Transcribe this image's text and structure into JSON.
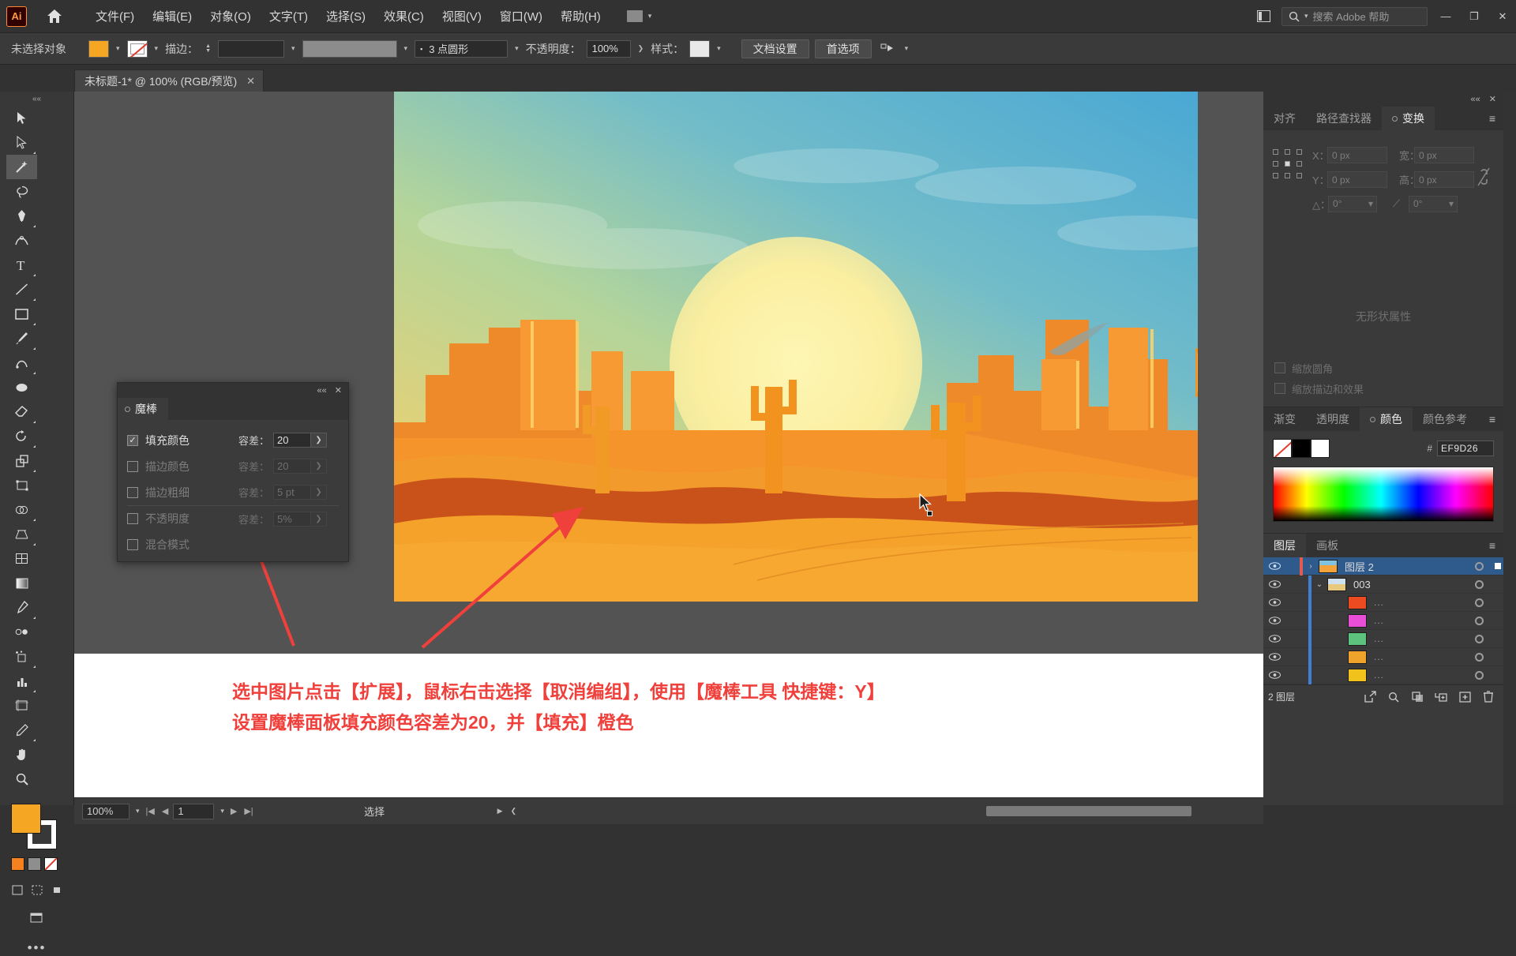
{
  "app": {
    "name": "Ai",
    "logo_label": "Ai"
  },
  "menubar": {
    "items": [
      {
        "label": "文件(F)",
        "name": "menu-file"
      },
      {
        "label": "编辑(E)",
        "name": "menu-edit"
      },
      {
        "label": "对象(O)",
        "name": "menu-object"
      },
      {
        "label": "文字(T)",
        "name": "menu-type"
      },
      {
        "label": "选择(S)",
        "name": "menu-select"
      },
      {
        "label": "效果(C)",
        "name": "menu-effect"
      },
      {
        "label": "视图(V)",
        "name": "menu-view"
      },
      {
        "label": "窗口(W)",
        "name": "menu-window"
      },
      {
        "label": "帮助(H)",
        "name": "menu-help"
      }
    ],
    "search_placeholder": "搜索 Adobe 帮助",
    "window_minimize": "—",
    "window_restore": "❐",
    "window_close": "✕"
  },
  "controlbar": {
    "selection_status": "未选择对象",
    "stroke_label": "描边：",
    "stroke_width": "",
    "stroke_profile": "3 点圆形",
    "opacity_label": "不透明度：",
    "opacity_value": "100%",
    "style_label": "样式：",
    "document_setup": "文档设置",
    "preferences": "首选项"
  },
  "document_tab": {
    "title": "未标题-1* @ 100% (RGB/预览)",
    "close": "✕"
  },
  "toolbar": {
    "tools": [
      "selection-tool",
      "direct-selection-tool",
      "magic-wand-tool",
      "lasso-tool",
      "pen-tool",
      "curvature-tool",
      "type-tool",
      "line-segment-tool",
      "rectangle-tool",
      "paintbrush-tool",
      "shaper-tool",
      "blob-brush-tool",
      "eraser-tool",
      "rotate-tool",
      "scale-tool",
      "free-transform-tool",
      "shape-builder-tool",
      "perspective-grid-tool",
      "mesh-tool",
      "gradient-tool",
      "eyedropper-tool",
      "blend-tool",
      "symbol-sprayer-tool",
      "column-graph-tool",
      "artboard-tool",
      "slice-tool",
      "hand-tool",
      "zoom-tool"
    ],
    "fill_color": "#F5A623",
    "stroke_color": "#FFFFFF",
    "more_tools": "•••"
  },
  "magic_wand_panel": {
    "tab_label": "魔棒",
    "close": "✕",
    "collapse": "««",
    "rows": [
      {
        "name": "fill-color",
        "label": "填充颜色",
        "checked": true,
        "tolerance_label": "容差：",
        "tolerance_value": "20",
        "enabled": true
      },
      {
        "name": "stroke-color",
        "label": "描边颜色",
        "checked": false,
        "tolerance_label": "容差：",
        "tolerance_value": "20",
        "enabled": false
      },
      {
        "name": "stroke-weight",
        "label": "描边粗细",
        "checked": false,
        "tolerance_label": "容差：",
        "tolerance_value": "5 pt",
        "enabled": false
      },
      {
        "name": "opacity",
        "label": "不透明度",
        "checked": false,
        "tolerance_label": "容差：",
        "tolerance_value": "5%",
        "enabled": false
      },
      {
        "name": "blending-mode",
        "label": "混合模式",
        "checked": false,
        "tolerance_label": "",
        "tolerance_value": "",
        "enabled": false
      }
    ]
  },
  "transform_panel": {
    "tabs": [
      {
        "label": "对齐",
        "active": false
      },
      {
        "label": "路径查找器",
        "active": false
      },
      {
        "label": "变换",
        "active": true
      }
    ],
    "fields": {
      "x_label": "X：",
      "x_value": "0 px",
      "y_label": "Y：",
      "y_value": "0 px",
      "w_label": "宽：",
      "w_value": "0 px",
      "h_label": "高：",
      "h_value": "0 px",
      "angle_label": "△：",
      "angle_value": "0°",
      "shear_label": "",
      "shear_value": "0°"
    },
    "empty_text": "无形状属性",
    "checkboxes": [
      {
        "label": "缩放圆角",
        "checked": false
      },
      {
        "label": "缩放描边和效果",
        "checked": false
      }
    ],
    "menu_icon": "≡"
  },
  "color_panel": {
    "tabs": [
      {
        "label": "渐变",
        "active": false
      },
      {
        "label": "透明度",
        "active": false
      },
      {
        "label": "颜色",
        "active": true
      },
      {
        "label": "颜色参考",
        "active": false
      }
    ],
    "hex_label": "#",
    "hex_value": "EF9D26",
    "menu_icon": "≡"
  },
  "layers_panel": {
    "tabs": [
      {
        "label": "图层",
        "active": true
      },
      {
        "label": "画板",
        "active": false
      }
    ],
    "menu_icon": "≡",
    "rows": [
      {
        "name": "layer-2",
        "label": "图层 2",
        "selected": true,
        "indent": 0,
        "twist": "›",
        "thumb": "#e98a3c",
        "eye": true
      },
      {
        "name": "group-003",
        "label": "003",
        "selected": false,
        "indent": 1,
        "twist": "⌄",
        "thumb": "#b6c9d8",
        "eye": true
      },
      {
        "name": "sublayer-1",
        "label": "...",
        "selected": false,
        "indent": 2,
        "twist": "",
        "thumb": "#ec4a21",
        "eye": true
      },
      {
        "name": "sublayer-2",
        "label": "...",
        "selected": false,
        "indent": 2,
        "twist": "",
        "thumb": "#e84fd6",
        "eye": true
      },
      {
        "name": "sublayer-3",
        "label": "...",
        "selected": false,
        "indent": 2,
        "twist": "",
        "thumb": "#5dc27e",
        "eye": true
      },
      {
        "name": "sublayer-4",
        "label": "...",
        "selected": false,
        "indent": 2,
        "twist": "",
        "thumb": "#f0a32a",
        "eye": true
      },
      {
        "name": "sublayer-5",
        "label": "...",
        "selected": false,
        "indent": 2,
        "twist": "",
        "thumb": "#f2c21c",
        "eye": true
      }
    ],
    "footer_count": "2 图层",
    "footer_buttons": [
      "release-to-layers",
      "locate-object",
      "make-clipping-mask",
      "create-sublayer",
      "create-new-layer",
      "delete-layer"
    ]
  },
  "statusbar": {
    "zoom": "100%",
    "page": "1",
    "status_text": "选择",
    "first": "|◀",
    "prev": "◀",
    "next": "▶",
    "last": "▶|"
  },
  "annotation": {
    "line1": "选中图片点击【扩展】，鼠标右击选择【取消编组】，使用【魔棒工具 快捷键：Y】",
    "line2": "设置魔棒面板填充颜色容差为20，并【填充】橙色",
    "color": "#F0403C"
  },
  "artwork": {
    "title": "desert-sunset-illustration",
    "sky_top": "#5cb3d9",
    "sky_mid": "#a9cf9a",
    "sun": "#fbf3a8",
    "sand": "#f7a22b",
    "rock_dark": "#c9521a",
    "rock_mid": "#e8721f",
    "cactus": "#f39324"
  }
}
